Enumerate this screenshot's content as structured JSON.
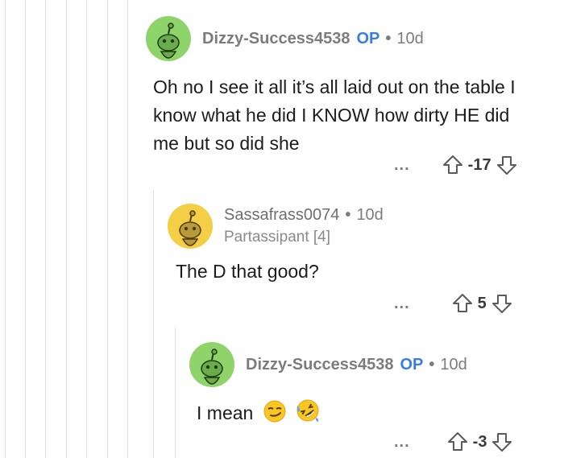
{
  "comments": [
    {
      "username": "Dizzy-Success4538",
      "op_badge": "OP",
      "separator": "•",
      "age": "10d",
      "body": "Oh no I see it all it’s all laid out on the table I know what he did I KNOW how dirty HE did me but so did she",
      "more": "...",
      "score": "-17",
      "avatar_color": "#8fd46b"
    },
    {
      "username": "Sassafrass0074",
      "separator": "•",
      "age": "10d",
      "flair": "Partassipant [4]",
      "body": "The D that good?",
      "more": "...",
      "score": "5",
      "avatar_color": "#f4cf46"
    },
    {
      "username": "Dizzy-Success4538",
      "op_badge": "OP",
      "separator": "•",
      "age": "10d",
      "body": "I mean",
      "emojis": [
        "smirking-face-emoji",
        "rolling-laughing-emoji"
      ],
      "more": "...",
      "score": "-3",
      "avatar_color": "#8fd46b"
    }
  ],
  "icons": {
    "upvote": "upvote-arrow-icon",
    "downvote": "downvote-arrow-icon"
  }
}
